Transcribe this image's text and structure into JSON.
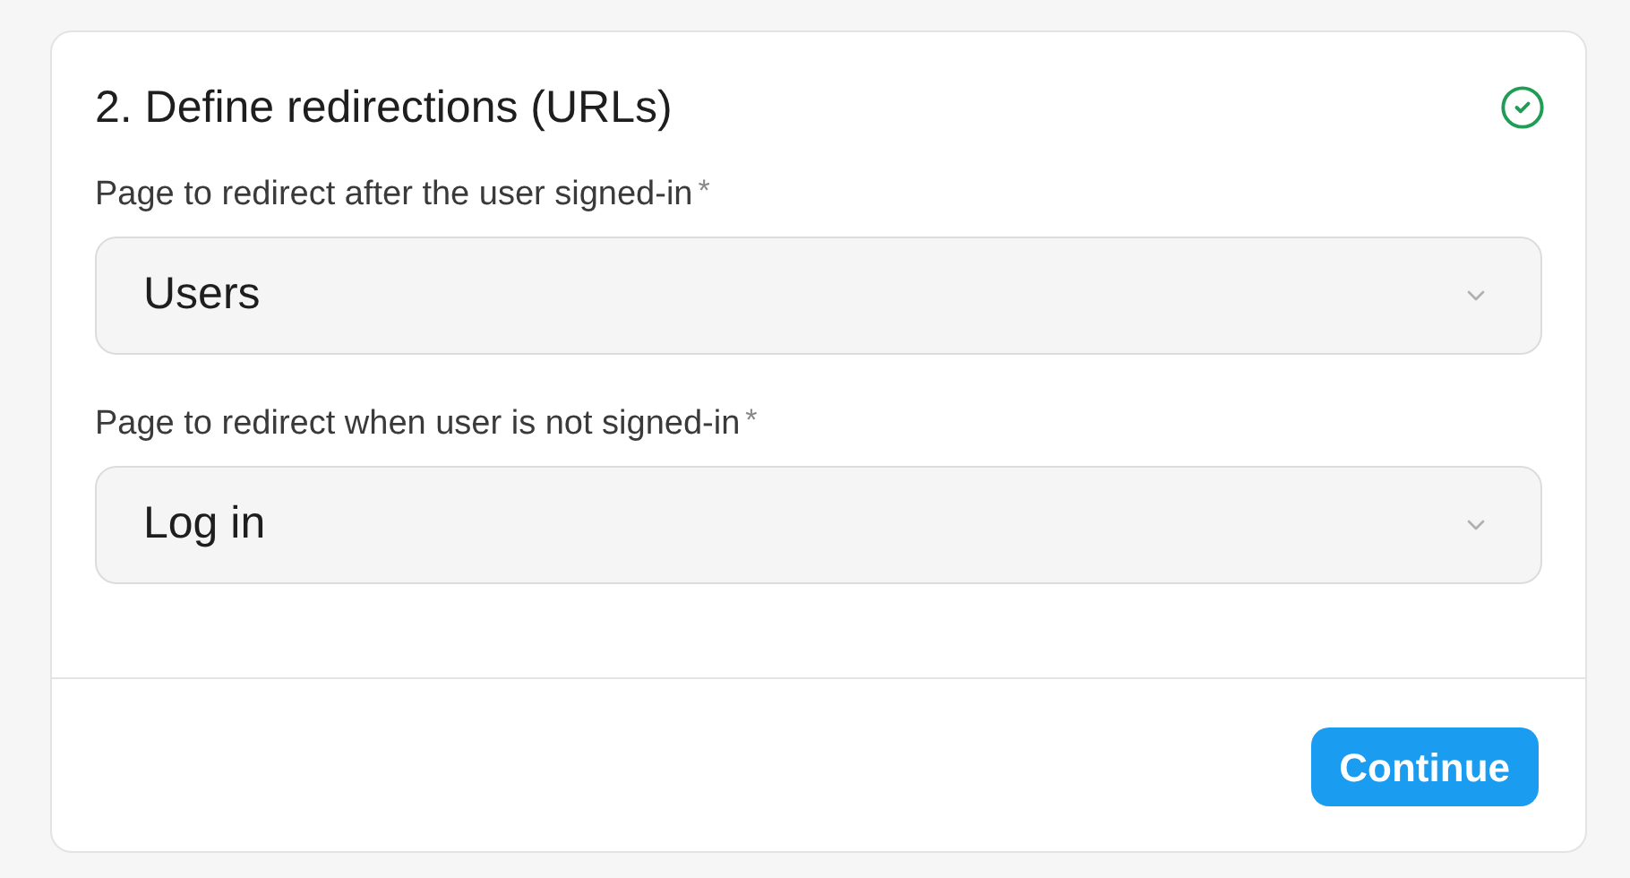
{
  "card": {
    "title": "2. Define redirections (URLs)",
    "completed": true
  },
  "fields": [
    {
      "label": "Page to redirect after the user signed-in",
      "required_mark": "*",
      "value": "Users"
    },
    {
      "label": "Page to redirect when user is not signed-in",
      "required_mark": "*",
      "value": "Log in"
    }
  ],
  "buttons": [
    "Continue"
  ]
}
